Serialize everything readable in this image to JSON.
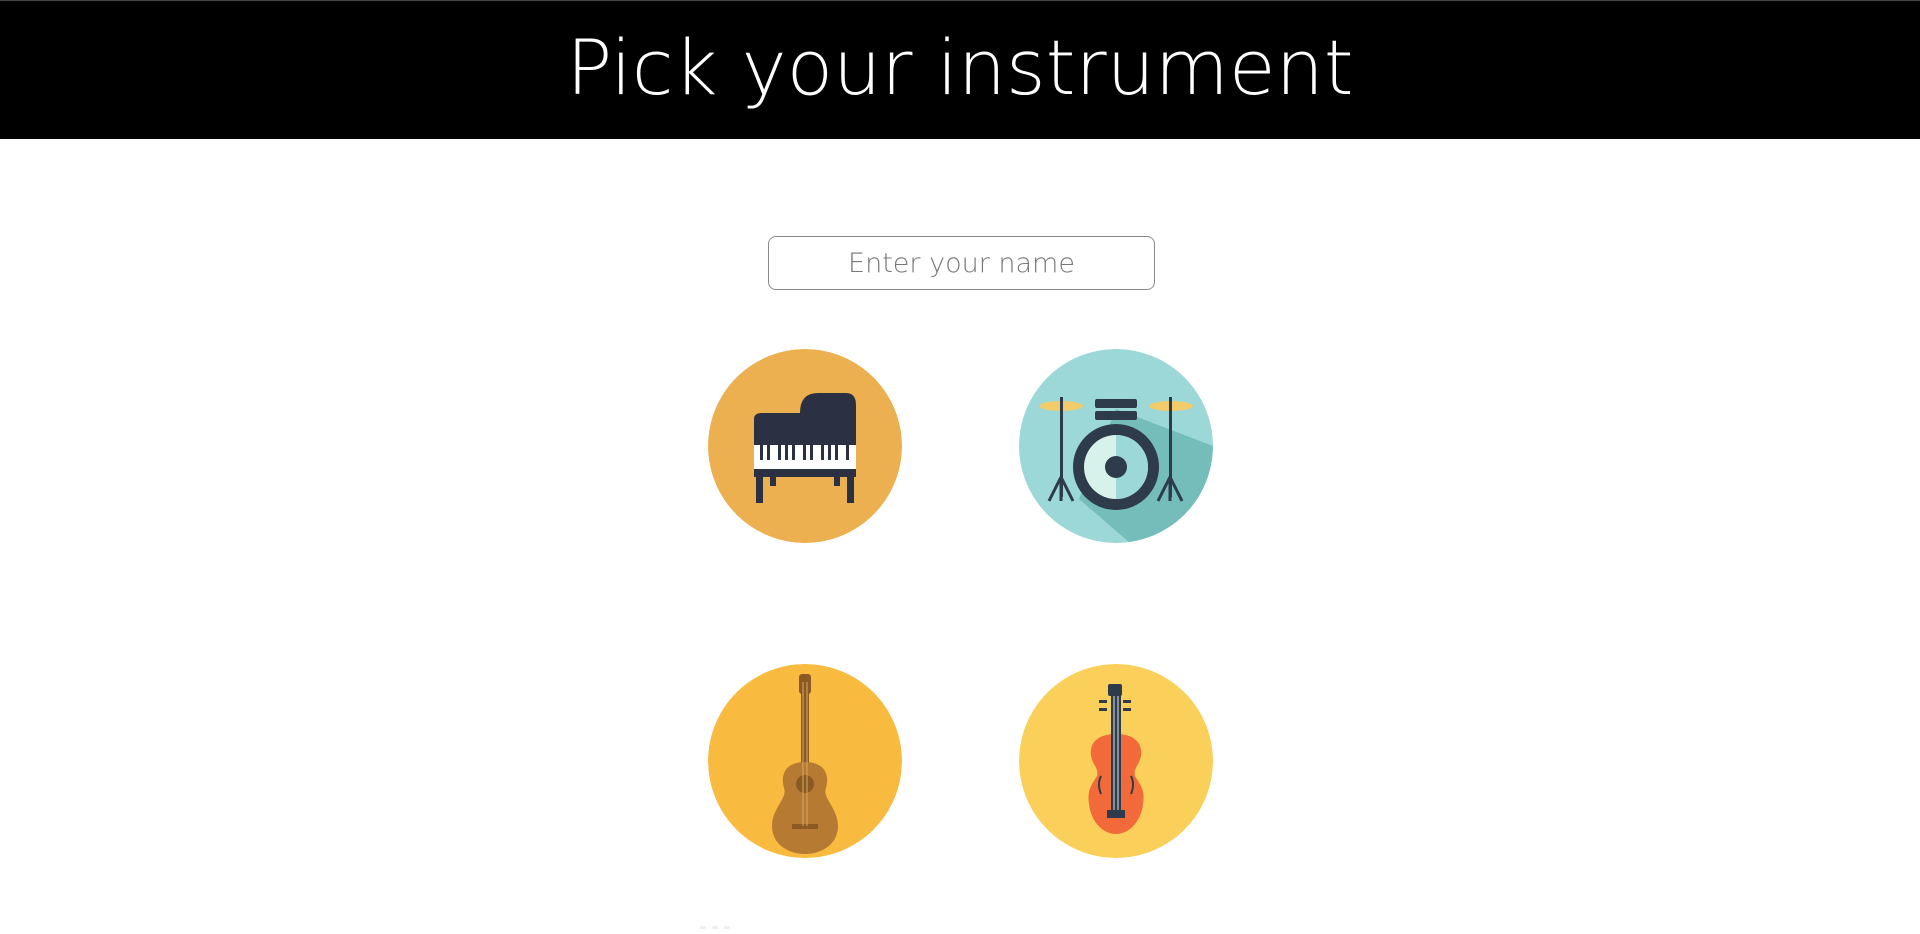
{
  "header": {
    "title": "Pick your instrument"
  },
  "name_input": {
    "placeholder": "Enter your name",
    "value": ""
  },
  "instruments": [
    {
      "id": "piano",
      "icon": "piano-icon",
      "bg": "#ECB050"
    },
    {
      "id": "drums",
      "icon": "drum-kit-icon",
      "bg": "#9BD8D7"
    },
    {
      "id": "guitar",
      "icon": "guitar-icon",
      "bg": "#F8BB40"
    },
    {
      "id": "violin",
      "icon": "violin-icon",
      "bg": "#FBD05A"
    }
  ],
  "colors": {
    "header_bg": "#000000",
    "header_text": "#FFFFFF",
    "piano_body": "#2B3142",
    "drum_dark": "#2E3B4A",
    "guitar_body": "#B67A33",
    "violin_body": "#F26A3A"
  }
}
